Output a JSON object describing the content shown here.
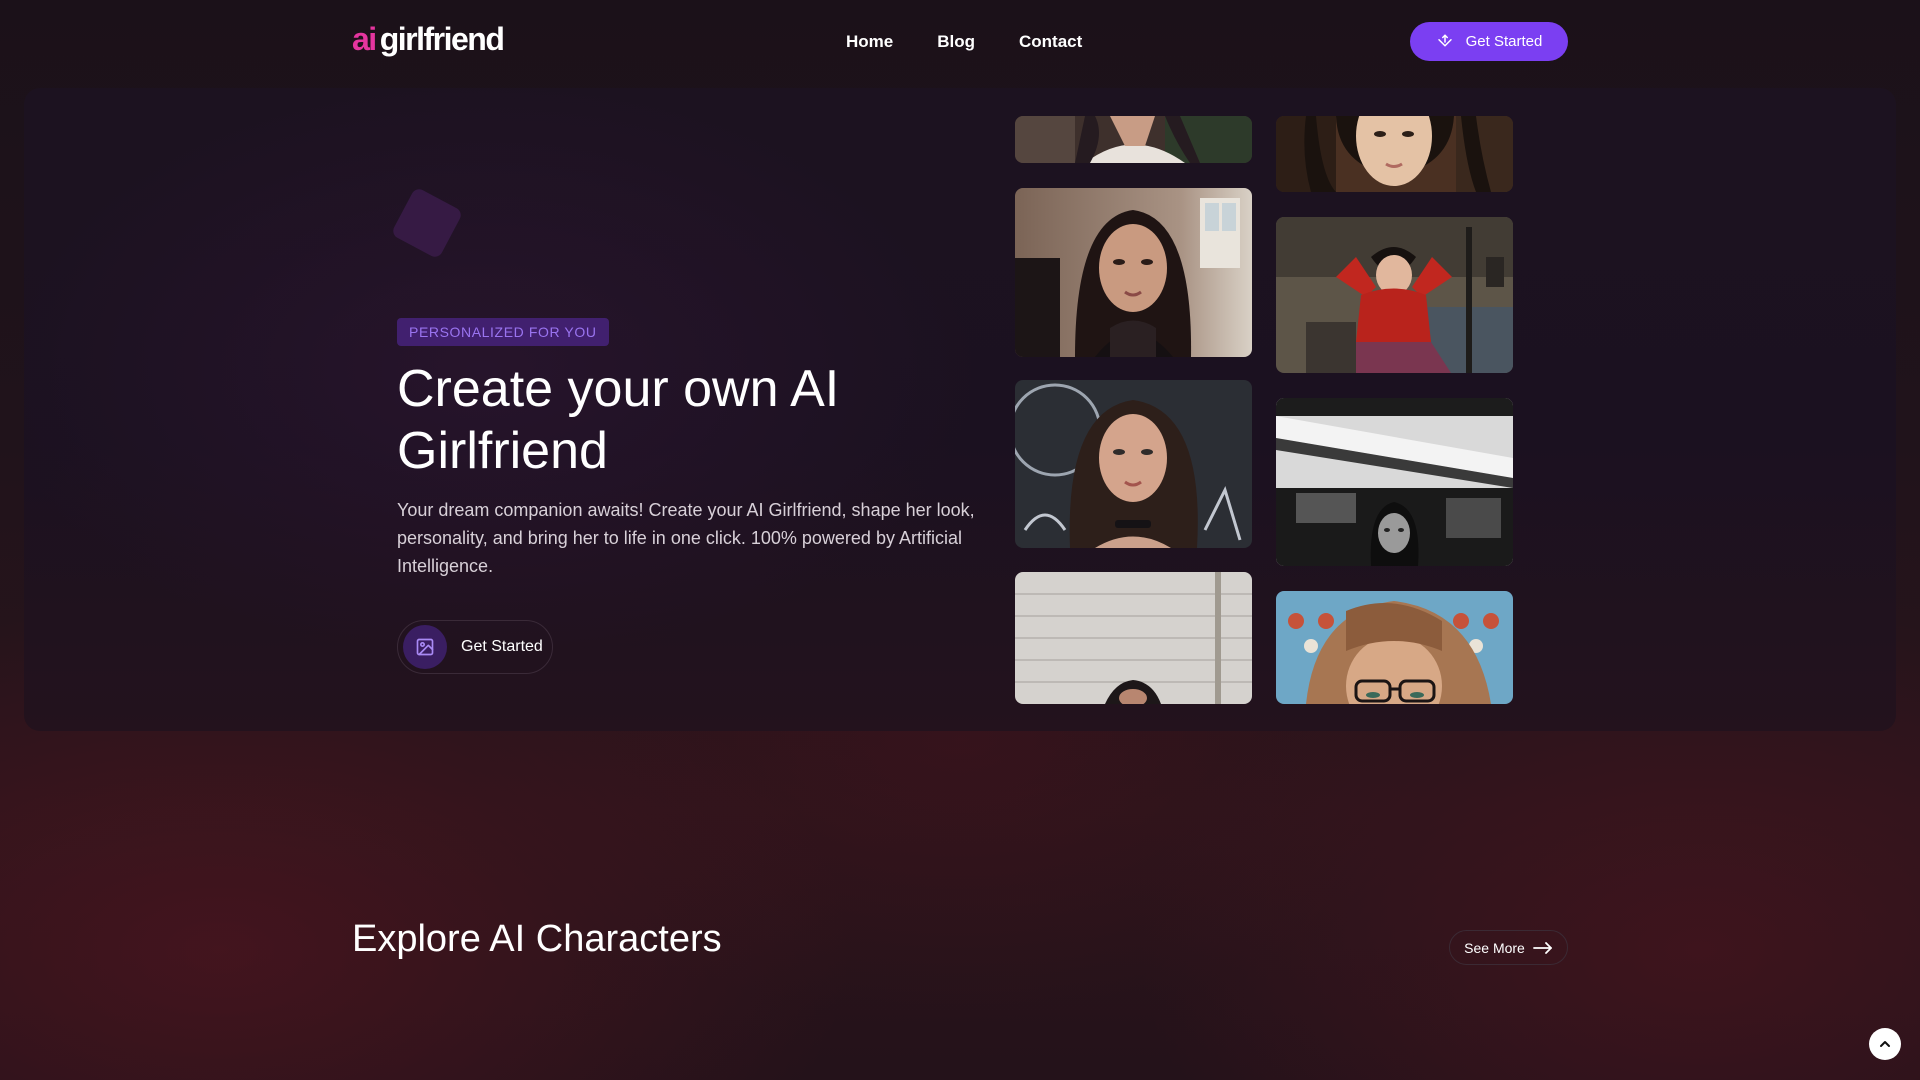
{
  "header": {
    "logo": {
      "prefix": "ai",
      "name": "girlfriend"
    },
    "nav": [
      {
        "label": "Home"
      },
      {
        "label": "Blog"
      },
      {
        "label": "Contact"
      }
    ],
    "cta_label": "Get Started",
    "cta_icon": "diamond-arrow-icon"
  },
  "hero": {
    "badge": "PERSONALIZED FOR YOU",
    "title": "Create your own AI Girlfriend",
    "description": "Your dream companion awaits! Create your AI Girlfriend, shape her look, personality, and bring her to life in one click. 100% powered by Artificial Intelligence.",
    "cta_label": "Get Started",
    "cta_icon": "image-icon"
  },
  "gallery": {
    "photos": [
      {
        "name": "photo-woman-white-top",
        "palette": [
          "#4b3a36",
          "#cfc6bf"
        ]
      },
      {
        "name": "photo-woman-dark-hair-lace",
        "palette": [
          "#7a6458",
          "#2b1d1b"
        ]
      },
      {
        "name": "photo-woman-neon-background",
        "palette": [
          "#3c4148",
          "#1e1f24"
        ]
      },
      {
        "name": "photo-woman-white-brick-wall",
        "palette": [
          "#d9d6d2",
          "#b9b5b1"
        ]
      },
      {
        "name": "photo-woman-restaurant",
        "palette": [
          "#5a3b2a",
          "#c89c7a"
        ]
      },
      {
        "name": "photo-woman-red-jacket",
        "palette": [
          "#6c6358",
          "#b3261e"
        ]
      },
      {
        "name": "photo-woman-black-white",
        "palette": [
          "#e8e8e8",
          "#202020"
        ]
      },
      {
        "name": "photo-woman-glasses",
        "palette": [
          "#5a9bbf",
          "#b88660"
        ]
      }
    ]
  },
  "explore": {
    "title": "Explore AI Characters",
    "see_more_label": "See More",
    "see_more_icon": "arrow-right-icon"
  },
  "scroll_top_icon": "chevron-up-icon",
  "colors": {
    "accent": "#7b3ff2",
    "logo_accent": "#e5359f",
    "badge_bg": "#41206f",
    "badge_text": "#9a74f0"
  }
}
